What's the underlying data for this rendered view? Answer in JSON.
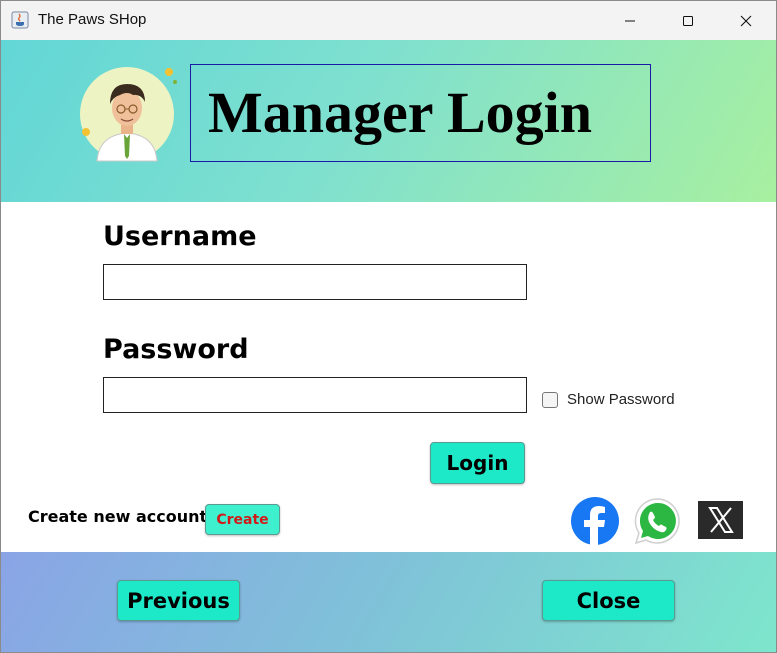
{
  "window": {
    "title": "The Paws SHop",
    "controls": [
      "minimize",
      "maximize",
      "close"
    ]
  },
  "header": {
    "title": "Manager Login",
    "avatar_icon": "manager-avatar-icon"
  },
  "form": {
    "username_label": "Username",
    "username_value": "",
    "password_label": "Password",
    "password_value": "",
    "show_password_label": "Show Password",
    "show_password_checked": false,
    "login_label": "Login"
  },
  "account": {
    "create_text": "Create new account",
    "create_button": "Create"
  },
  "social": [
    "facebook-icon",
    "whatsapp-icon",
    "x-icon"
  ],
  "footer": {
    "previous_label": "Previous",
    "close_label": "Close"
  },
  "colors": {
    "button": "#1de8c8",
    "header_start": "#62d6d6",
    "header_end": "#a8f0a0",
    "footer_start": "#8aa4e6",
    "footer_end": "#7ee6cc",
    "create_text": "#d11a1a"
  }
}
